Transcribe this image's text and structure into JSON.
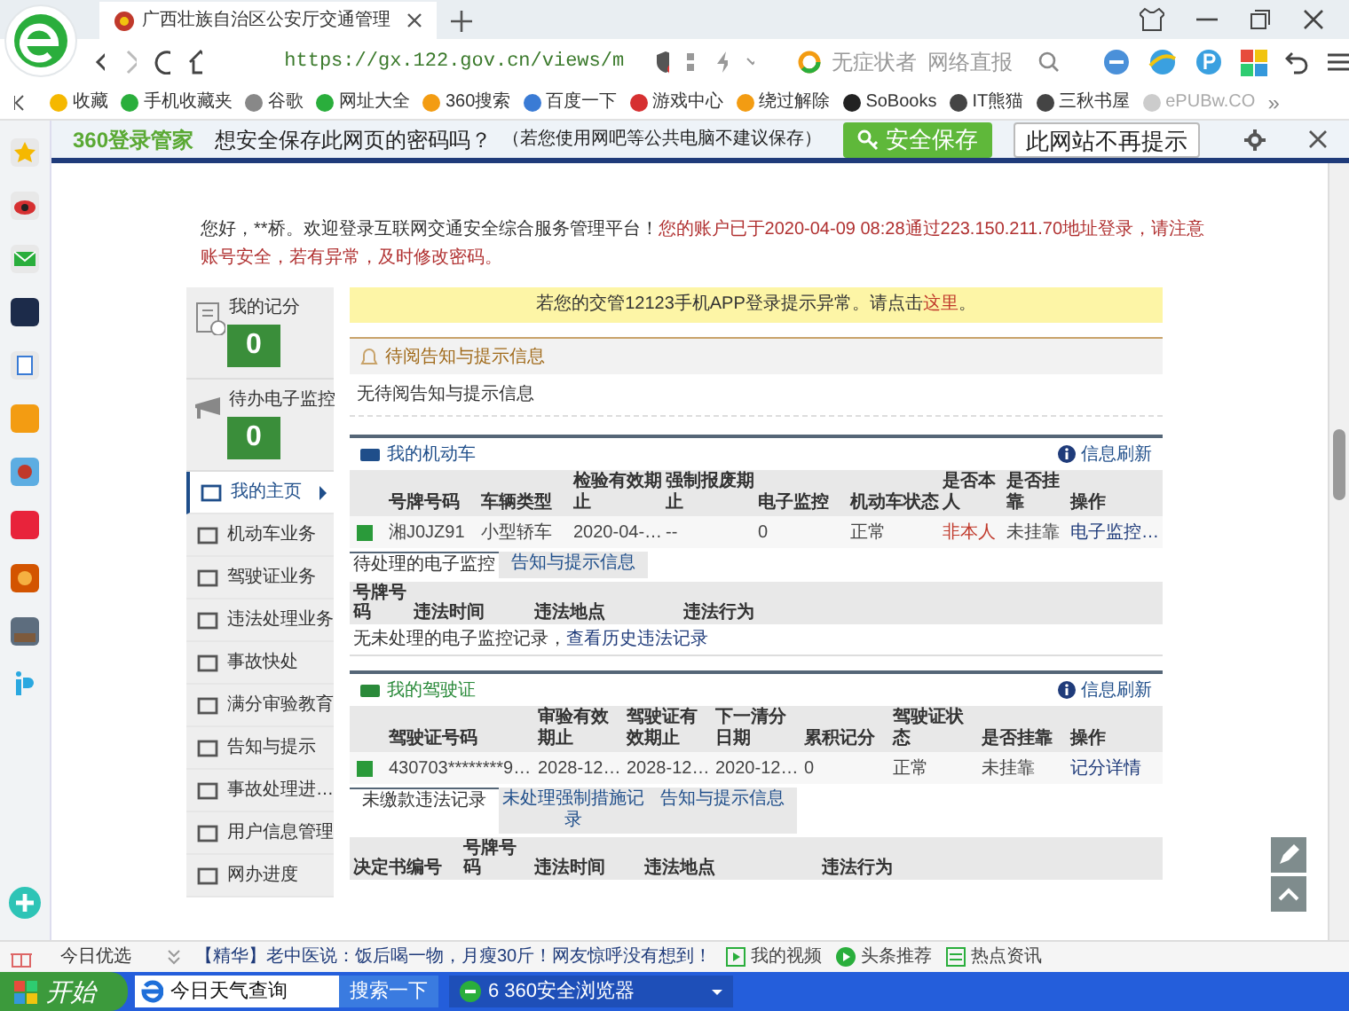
{
  "browser": {
    "tab_title": "广西壮族自治区公安厅交通管理",
    "url": "https://gx.122.gov.cn/views/m",
    "search_suggestions": [
      "无症状者",
      "网络直报"
    ],
    "bookmarks": [
      {
        "label": "收藏"
      },
      {
        "label": "手机收藏夹"
      },
      {
        "label": "谷歌"
      },
      {
        "label": "网址大全"
      },
      {
        "label": "360搜索"
      },
      {
        "label": "百度一下"
      },
      {
        "label": "游戏中心"
      },
      {
        "label": "绕过解除"
      },
      {
        "label": "SoBooks"
      },
      {
        "label": "IT熊猫"
      },
      {
        "label": "三秋书屋"
      },
      {
        "label": "ePUBw.CO"
      }
    ],
    "more": "»"
  },
  "password_bar": {
    "brand": "360登录管家",
    "question": "想安全保存此网页的密码吗？",
    "note": "（若您使用网吧等公共电脑不建议保存）",
    "save_button": "安全保存",
    "dismiss_button": "此网站不再提示"
  },
  "greeting": {
    "text": "您好，**桥。欢迎登录互联网交通安全综合服务管理平台！",
    "account_notice": "您的账户已于2020-04-09 08:28通过223.150.211.70地址登录，请注意账号安全，若有异常，及时修改密码。"
  },
  "stats": [
    {
      "label": "我的记分",
      "value": "0"
    },
    {
      "label": "待办电子监控",
      "value": "0"
    }
  ],
  "nav": [
    {
      "label": "我的主页",
      "selected": true
    },
    {
      "label": "机动车业务",
      "selected": false
    },
    {
      "label": "驾驶证业务",
      "selected": false
    },
    {
      "label": "违法处理业务",
      "selected": false
    },
    {
      "label": "事故快处",
      "selected": false
    },
    {
      "label": "满分审验教育",
      "selected": false
    },
    {
      "label": "告知与提示",
      "selected": false
    },
    {
      "label": "事故处理进…",
      "selected": false
    },
    {
      "label": "用户信息管理",
      "selected": false
    },
    {
      "label": "网办进度",
      "selected": false
    }
  ],
  "banner": {
    "text": "若您的交管12123手机APP登录提示异常。请点击",
    "link": "这里",
    "end": "。"
  },
  "notices": {
    "title": "待阅告知与提示信息",
    "empty": "无待阅告知与提示信息"
  },
  "vehicles": {
    "title": "我的机动车",
    "refresh": "信息刷新",
    "columns": [
      "号牌号码",
      "车辆类型",
      "检验有效期止",
      "强制报废期止",
      "电子监控",
      "机动车状态",
      "是否本人",
      "是否挂靠",
      "操作"
    ],
    "rows": [
      {
        "cells": [
          {
            "text": "湘J0JZ91",
            "kind": "text"
          },
          {
            "text": "小型轿车",
            "kind": "text"
          },
          {
            "text": "2020-04-…",
            "kind": "text"
          },
          {
            "text": "--",
            "kind": "text"
          },
          {
            "text": "0",
            "kind": "text"
          },
          {
            "text": "正常",
            "kind": "text"
          },
          {
            "text": "非本人",
            "kind": "warning"
          },
          {
            "text": "未挂靠",
            "kind": "text"
          },
          {
            "text": "电子监控…",
            "kind": "link"
          }
        ]
      }
    ],
    "tabs": [
      {
        "label": "待处理的电子监控",
        "selected": true
      },
      {
        "label": "告知与提示信息",
        "selected": false
      }
    ],
    "sub_columns": [
      "号牌号码",
      "违法时间",
      "违法地点",
      "违法行为"
    ],
    "empty_text": "无未处理的电子监控记录，",
    "history_link": "查看历史违法记录"
  },
  "license": {
    "title": "我的驾驶证",
    "refresh": "信息刷新",
    "columns": [
      "驾驶证号码",
      "审验有效期止",
      "驾驶证有效期止",
      "下一清分日期",
      "累积记分",
      "驾驶证状态",
      "是否挂靠",
      "操作"
    ],
    "rows": [
      {
        "cells": [
          {
            "text": "430703********9…",
            "kind": "text"
          },
          {
            "text": "2028-12…",
            "kind": "text"
          },
          {
            "text": "2028-12…",
            "kind": "text"
          },
          {
            "text": "2020-12…",
            "kind": "text"
          },
          {
            "text": "0",
            "kind": "text"
          },
          {
            "text": "正常",
            "kind": "text"
          },
          {
            "text": "未挂靠",
            "kind": "text"
          },
          {
            "text": "记分详情",
            "kind": "link"
          }
        ]
      }
    ],
    "tabs": [
      {
        "label": "未缴款违法记录",
        "selected": true
      },
      {
        "label": "未处理强制措施记录",
        "selected": false
      },
      {
        "label": "告知与提示信息",
        "selected": false
      }
    ],
    "sub_columns": [
      "决定书编号",
      "号牌号码",
      "违法时间",
      "违法地点",
      "违法行为"
    ]
  },
  "news_bar": {
    "label": "今日优选",
    "headline": "【精华】老中医说：饭后喝一物，月瘦30斤！网友惊呼没有想到！",
    "links": [
      "我的视频",
      "头条推荐",
      "热点资讯"
    ]
  },
  "taskbar": {
    "start": "开始",
    "search_value": "今日天气查询",
    "search_button": "搜索一下",
    "task": "6 360安全浏览器"
  }
}
